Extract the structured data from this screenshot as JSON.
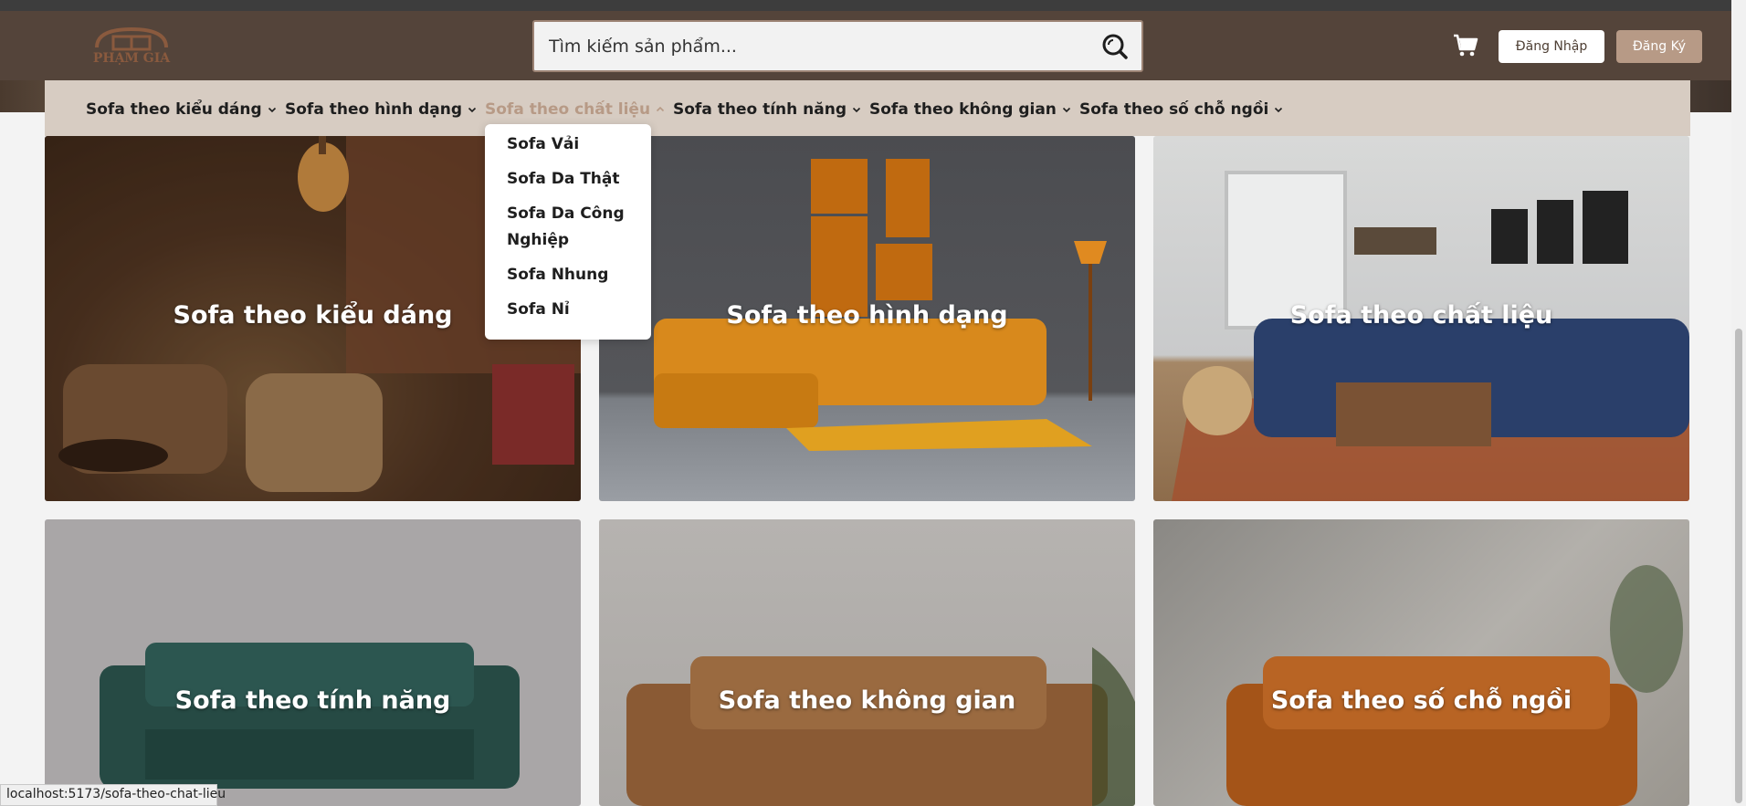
{
  "brand": {
    "logo_text": "PHẠM GIA",
    "accent": "#b79a86",
    "header_bg": "#54443a"
  },
  "search": {
    "placeholder": "Tìm kiếm sản phẩm..."
  },
  "auth": {
    "login_label": "Đăng Nhập",
    "register_label": "Đăng Ký"
  },
  "nav": {
    "items": [
      {
        "label": "Sofa theo kiểu dáng"
      },
      {
        "label": "Sofa theo hình dạng"
      },
      {
        "label": "Sofa theo chất liệu",
        "active": true
      },
      {
        "label": "Sofa theo tính năng"
      },
      {
        "label": "Sofa theo không gian"
      },
      {
        "label": "Sofa theo số chỗ ngồi"
      }
    ]
  },
  "dropdown": {
    "items": [
      {
        "label": "Sofa Vải"
      },
      {
        "label": "Sofa Da Thật"
      },
      {
        "label": "Sofa Da Công Nghiệp"
      },
      {
        "label": "Sofa Nhung"
      },
      {
        "label": "Sofa Nỉ"
      }
    ]
  },
  "categories": [
    {
      "title": "Sofa theo kiểu dáng"
    },
    {
      "title": "Sofa theo hình dạng"
    },
    {
      "title": "Sofa theo chất liệu"
    },
    {
      "title": "Sofa theo tính năng"
    },
    {
      "title": "Sofa theo không gian"
    },
    {
      "title": "Sofa theo số chỗ ngồi"
    }
  ],
  "status": {
    "url": "localhost:5173/sofa-theo-chat-lieu"
  },
  "icons": {
    "search": "search-icon",
    "cart": "cart-icon",
    "chevron": "chevron-down-icon"
  }
}
